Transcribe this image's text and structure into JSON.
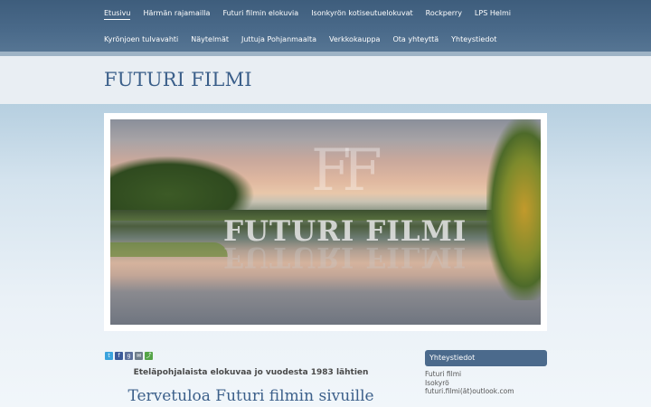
{
  "nav": {
    "row1": [
      "Etusivu",
      "Härmän rajamailla",
      "Futuri filmin elokuvia",
      "Isonkyrön kotiseutuelokuvat",
      "Rockperry",
      "LPS Helmi"
    ],
    "row2": [
      "Kyrönjoen tulvavahti",
      "Näytelmät",
      "Juttuja Pohjanmaalta",
      "Verkkokauppa",
      "Ota yhteyttä",
      "Yhteystiedot"
    ],
    "active": "Etusivu"
  },
  "site": {
    "title": "FUTURI FILMI"
  },
  "hero": {
    "monogram": "FF",
    "overlay_text": "FUTURI FILMI"
  },
  "share": {
    "icons": [
      "twitter-icon",
      "facebook-icon",
      "google-plus-icon",
      "email-icon",
      "share-icon"
    ],
    "glyphs": [
      "t",
      "f",
      "g",
      "✉",
      "⤴"
    ]
  },
  "content": {
    "tagline": "Eteläpohjalaista elokuvaa jo vuodesta 1983 lähtien",
    "welcome": "Tervetuloa Futuri filmin sivuille"
  },
  "sidebar": {
    "heading": "Yhteystiedot",
    "lines": [
      "Futuri filmi",
      "Isokyrö",
      "futuri.filmi(ät)outlook.com"
    ]
  },
  "colors": {
    "nav_bg": "#4a6a8a",
    "accent": "#3b5f8a",
    "sidebar_head": "#4b6a8c"
  }
}
